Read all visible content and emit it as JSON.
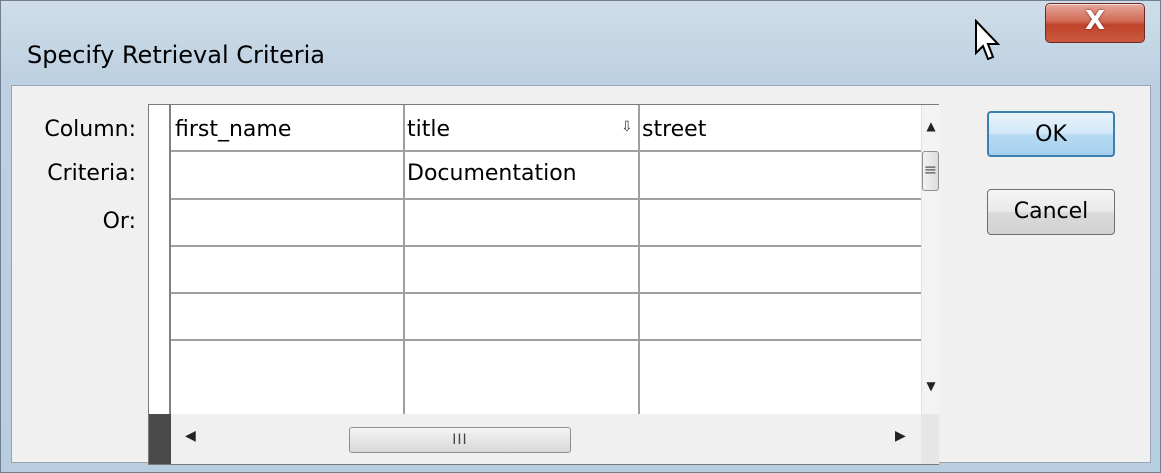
{
  "dialog": {
    "title": "Specify Retrieval Criteria",
    "close_label": "X"
  },
  "row_labels": {
    "column": "Column:",
    "criteria": "Criteria:",
    "or": "Or:"
  },
  "grid": {
    "columns": [
      "first_name",
      "title",
      "street"
    ],
    "criteria": [
      "",
      "Documentation",
      ""
    ],
    "or_rows": [
      [
        "",
        "",
        ""
      ],
      [
        "",
        "",
        ""
      ],
      [
        "",
        "",
        ""
      ],
      [
        "",
        "",
        ""
      ]
    ],
    "sort_indicator_column": "title"
  },
  "scrollbars": {
    "vertical": {
      "up": "▲",
      "grip": "≡",
      "down": "▼"
    },
    "horizontal": {
      "left": "◀",
      "grip": "III",
      "right": "▶"
    }
  },
  "buttons": {
    "ok": "OK",
    "cancel": "Cancel"
  },
  "icons": {
    "cursor": "arrow-cursor-icon",
    "sort": "sort-down-arrow-icon"
  }
}
